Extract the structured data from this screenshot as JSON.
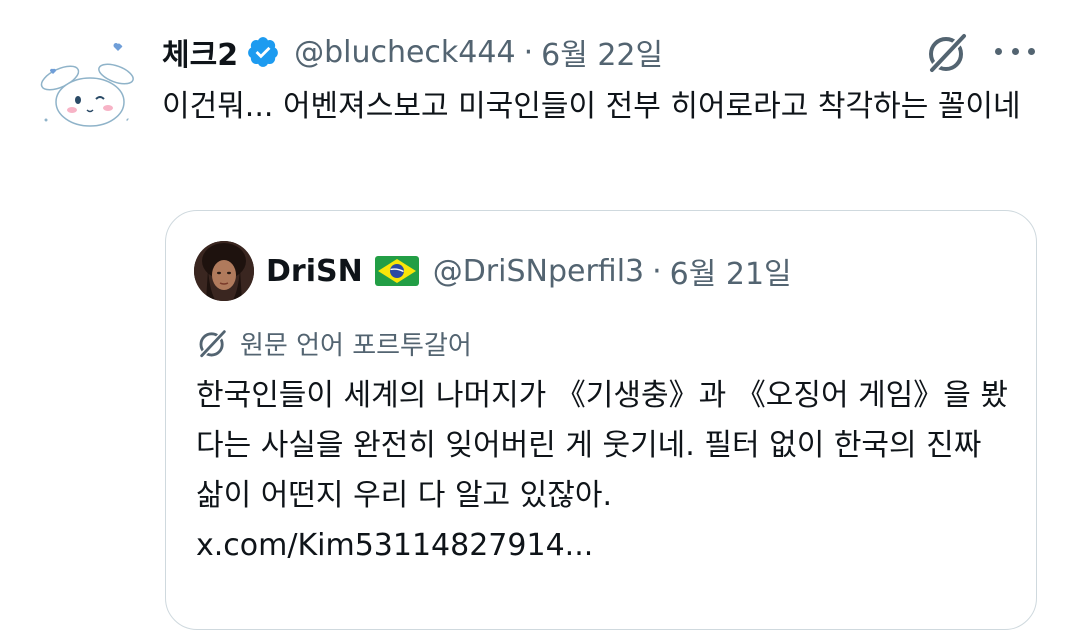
{
  "tweet": {
    "display_name": "체크2",
    "handle": "@blucheck444",
    "separator": "·",
    "date": "6월 22일",
    "text": "이건뭐... 어벤져스보고 미국인들이 전부 히어로라고 착각하는 꼴이네",
    "icons": {
      "avatar": "cinnamoroll-avatar",
      "verified": "verified-badge-icon",
      "grok": "grok-icon",
      "more": "more-options-icon"
    }
  },
  "quote": {
    "display_name": "DriSN",
    "handle": "@DriSNperfil3",
    "separator": "·",
    "date": "6월 21일",
    "translation_label": "원문 언어 포르투갈어",
    "text": "한국인들이 세계의 나머지가 《기생충》과 《오징어 게임》을 봤다는 사실을 완전히 잊어버린 게 웃기네. 필터 없이 한국의 진짜 삶이 어떤지 우리 다 알고 있잖아.",
    "link": "x.com/Kim53114827914...",
    "icons": {
      "flag": "brazil-flag-icon",
      "translate": "grok-translate-icon"
    }
  },
  "colors": {
    "text_primary": "#0f1419",
    "text_secondary": "#536471",
    "verified_blue": "#1d9bf0",
    "border": "#cfd9de"
  }
}
